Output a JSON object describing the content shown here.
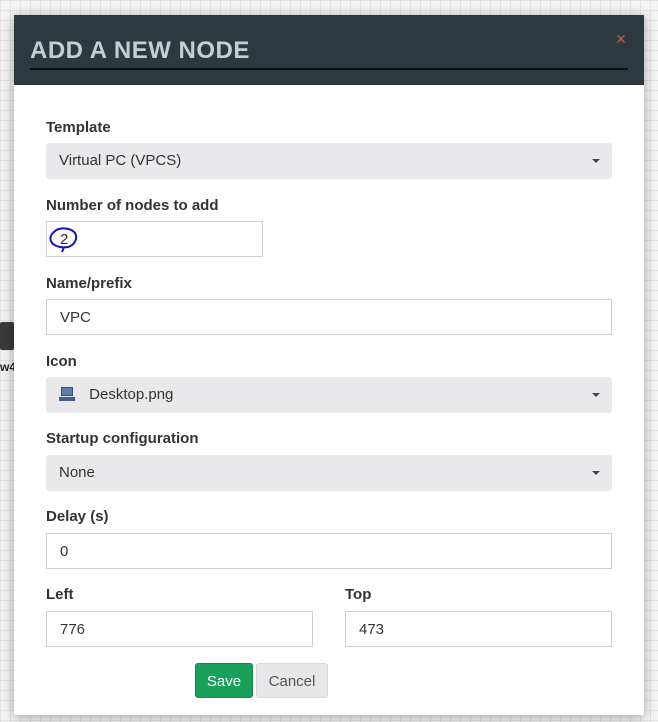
{
  "background": {
    "node_label": "w4"
  },
  "modal": {
    "title": "ADD A NEW NODE",
    "close_symbol": "×",
    "template": {
      "label": "Template",
      "value": "Virtual PC (VPCS)"
    },
    "nodes_count": {
      "label": "Number of nodes to add",
      "value": "2"
    },
    "name_prefix": {
      "label": "Name/prefix",
      "value": "VPC"
    },
    "icon": {
      "label": "Icon",
      "value": "Desktop.png",
      "icon_name": "desktop-pc-icon"
    },
    "startup_config": {
      "label": "Startup configuration",
      "value": "None"
    },
    "delay": {
      "label": "Delay (s)",
      "value": "0"
    },
    "left": {
      "label": "Left",
      "value": "776"
    },
    "top": {
      "label": "Top",
      "value": "473"
    },
    "buttons": {
      "save": "Save",
      "cancel": "Cancel"
    }
  },
  "colors": {
    "header_bg": "#2c3a3f",
    "title_text": "#c7ced1",
    "save_bg": "#19a05a",
    "close_icon": "#d9534f",
    "annotation_circle": "#1010c8"
  }
}
